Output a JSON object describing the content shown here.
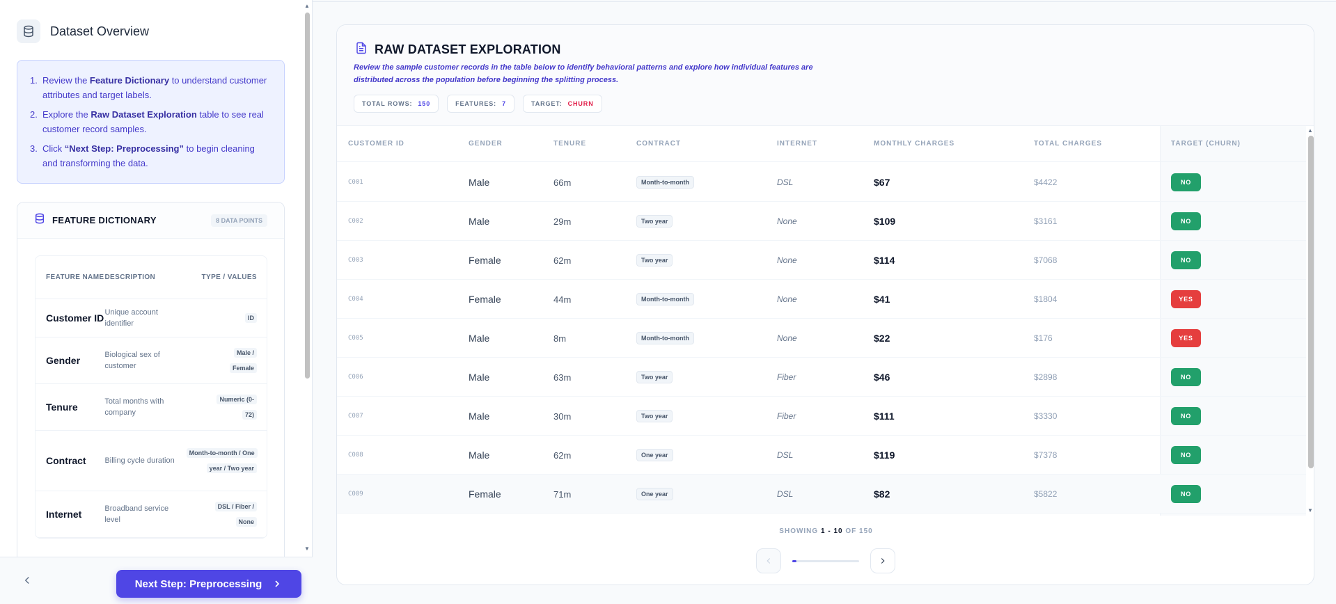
{
  "sidebar": {
    "title": "Dataset Overview",
    "steps": [
      {
        "num": "1.",
        "pre": "Review the ",
        "bold": "Feature Dictionary",
        "post": " to understand customer attributes and target labels."
      },
      {
        "num": "2.",
        "pre": "Explore the ",
        "bold": "Raw Dataset Exploration",
        "post": " table to see real customer record samples."
      },
      {
        "num": "3.",
        "pre": "Click ",
        "bold": "“Next Step: Preprocessing”",
        "post": " to begin cleaning and transforming the data."
      }
    ],
    "feature_dictionary": {
      "title": "FEATURE DICTIONARY",
      "badge": "8 DATA POINTS",
      "headers": {
        "name": "FEATURE NAME",
        "description": "DESCRIPTION",
        "type": "TYPE / VALUES"
      },
      "rows": [
        {
          "name": "Customer ID",
          "description": "Unique account identifier",
          "type": "ID"
        },
        {
          "name": "Gender",
          "description": "Biological sex of customer",
          "type": "Male / Female"
        },
        {
          "name": "Tenure",
          "description": "Total months with company",
          "type": "Numeric (0-72)"
        },
        {
          "name": "Contract",
          "description": "Billing cycle duration",
          "type": "Month-to-month / One year / Two year"
        },
        {
          "name": "Internet",
          "description": "Broadband service level",
          "type": "DSL / Fiber / None"
        }
      ]
    },
    "next_button": "Next Step: Preprocessing"
  },
  "main": {
    "title": "RAW DATASET EXPLORATION",
    "subtitle": "Review the sample customer records in the table below to identify behavioral patterns and explore how individual features are distributed across the population before beginning the splitting process.",
    "chips": [
      {
        "label": "TOTAL ROWS:",
        "value": "150"
      },
      {
        "label": "FEATURES:",
        "value": "7"
      },
      {
        "label": "TARGET:",
        "value": "CHURN"
      }
    ],
    "columns": [
      "CUSTOMER ID",
      "GENDER",
      "TENURE",
      "CONTRACT",
      "INTERNET",
      "MONTHLY CHARGES",
      "TOTAL CHARGES",
      "TARGET (CHURN)"
    ],
    "rows": [
      {
        "id": "C001",
        "gender": "Male",
        "tenure": "66m",
        "contract": "Month-to-month",
        "internet": "DSL",
        "monthly": "$67",
        "total": "$4422",
        "target": "NO"
      },
      {
        "id": "C002",
        "gender": "Male",
        "tenure": "29m",
        "contract": "Two year",
        "internet": "None",
        "monthly": "$109",
        "total": "$3161",
        "target": "NO"
      },
      {
        "id": "C003",
        "gender": "Female",
        "tenure": "62m",
        "contract": "Two year",
        "internet": "None",
        "monthly": "$114",
        "total": "$7068",
        "target": "NO"
      },
      {
        "id": "C004",
        "gender": "Female",
        "tenure": "44m",
        "contract": "Month-to-month",
        "internet": "None",
        "monthly": "$41",
        "total": "$1804",
        "target": "YES"
      },
      {
        "id": "C005",
        "gender": "Male",
        "tenure": "8m",
        "contract": "Month-to-month",
        "internet": "None",
        "monthly": "$22",
        "total": "$176",
        "target": "YES"
      },
      {
        "id": "C006",
        "gender": "Male",
        "tenure": "63m",
        "contract": "Two year",
        "internet": "Fiber",
        "monthly": "$46",
        "total": "$2898",
        "target": "NO"
      },
      {
        "id": "C007",
        "gender": "Male",
        "tenure": "30m",
        "contract": "Two year",
        "internet": "Fiber",
        "monthly": "$111",
        "total": "$3330",
        "target": "NO"
      },
      {
        "id": "C008",
        "gender": "Male",
        "tenure": "62m",
        "contract": "One year",
        "internet": "DSL",
        "monthly": "$119",
        "total": "$7378",
        "target": "NO"
      },
      {
        "id": "C009",
        "gender": "Female",
        "tenure": "71m",
        "contract": "One year",
        "internet": "DSL",
        "monthly": "$82",
        "total": "$5822",
        "target": "NO"
      }
    ],
    "pagination": {
      "showing": "SHOWING",
      "from": "1",
      "dash": "-",
      "to": "10",
      "of": "OF",
      "total": "150",
      "progress": 0.067
    }
  },
  "colors": {
    "accent": "#4f46e5",
    "no": "#22a06b",
    "yes": "#e53e3e",
    "target": "#e11d48"
  },
  "icons": {
    "overview": "database-icon",
    "feature_dictionary": "database-icon",
    "main_title": "file-text-icon",
    "back": "chevron-left-icon",
    "next": "chevron-right-icon"
  }
}
